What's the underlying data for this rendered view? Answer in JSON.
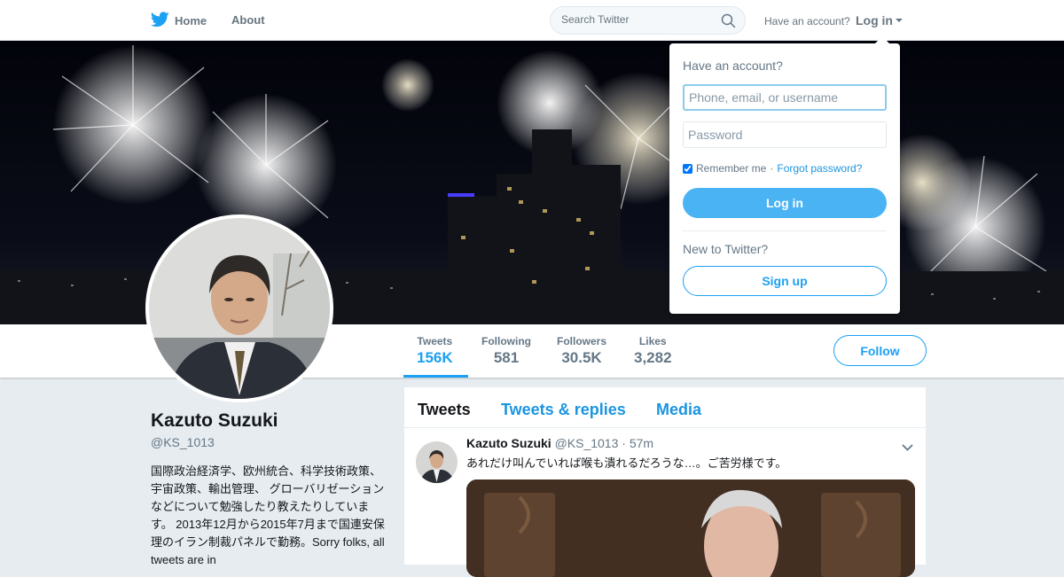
{
  "topbar": {
    "home_label": "Home",
    "about_label": "About",
    "search_placeholder": "Search Twitter",
    "account_question": "Have an account?",
    "login_label": "Log in"
  },
  "login_dropdown": {
    "title": "Have an account?",
    "username_placeholder": "Phone, email, or username",
    "password_placeholder": "Password",
    "remember_me": "Remember me",
    "separator": "·",
    "forgot_password": "Forgot password?",
    "login_button": "Log in",
    "new_to_twitter": "New to Twitter?",
    "signup_button": "Sign up"
  },
  "profile_nav": {
    "stats": [
      {
        "label": "Tweets",
        "value": "156K"
      },
      {
        "label": "Following",
        "value": "581"
      },
      {
        "label": "Followers",
        "value": "30.5K"
      },
      {
        "label": "Likes",
        "value": "3,282"
      }
    ],
    "follow_button": "Follow"
  },
  "profile": {
    "name": "Kazuto Suzuki",
    "handle": "@KS_1013",
    "bio": "国際政治経済学、欧州統合、科学技術政策、宇宙政策、輸出管理、 グローバリゼーションなどについて勉強したり教えたりしています。 2013年12月から2015年7月まで国連安保理のイラン制裁パネルで勤務。Sorry folks, all tweets are in"
  },
  "timeline": {
    "tabs": [
      "Tweets",
      "Tweets & replies",
      "Media"
    ],
    "tweet": {
      "name": "Kazuto Suzuki",
      "handle": "@KS_1013",
      "separator": "·",
      "time": "57m",
      "text": "あれだけ叫んでいれば喉も潰れるだろうな…。ご苦労様です。"
    }
  },
  "colors": {
    "accent": "#1da1f2",
    "background": "#e6ecf0",
    "muted": "#657786"
  }
}
